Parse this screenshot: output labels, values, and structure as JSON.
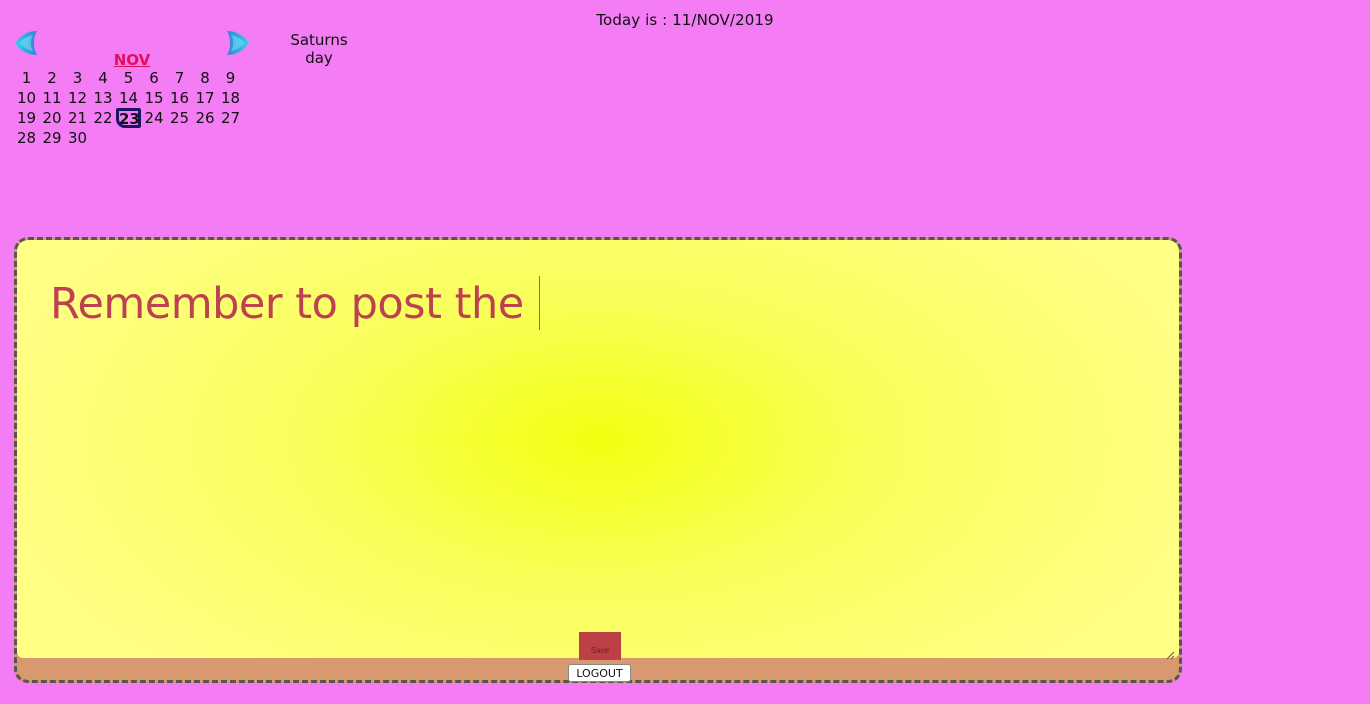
{
  "header": {
    "today": "Today is : 11/NOV/2019"
  },
  "calendar": {
    "month": "NOV",
    "day_name": "Saturns day",
    "prev_icon": "arrow-left-icon",
    "next_icon": "arrow-right-icon",
    "selected_day": "23",
    "weeks": [
      [
        "1",
        "2",
        "3",
        "4",
        "5",
        "6",
        "7",
        "8",
        "9"
      ],
      [
        "10",
        "11",
        "12",
        "13",
        "14",
        "15",
        "16",
        "17",
        "18"
      ],
      [
        "19",
        "20",
        "21",
        "22",
        "23",
        "24",
        "25",
        "26",
        "27"
      ],
      [
        "28",
        "29",
        "30"
      ]
    ]
  },
  "note": {
    "text": "Remember to post the "
  },
  "actions": {
    "save_label": "Save",
    "logout_label": "LOGOUT"
  },
  "colors": {
    "background": "#f47cf4",
    "month_label": "#e0105a",
    "note_text": "#bd4151",
    "note_bg_center": "#f2ff10",
    "note_footer": "#d89870",
    "save_button": "#bd4046"
  }
}
